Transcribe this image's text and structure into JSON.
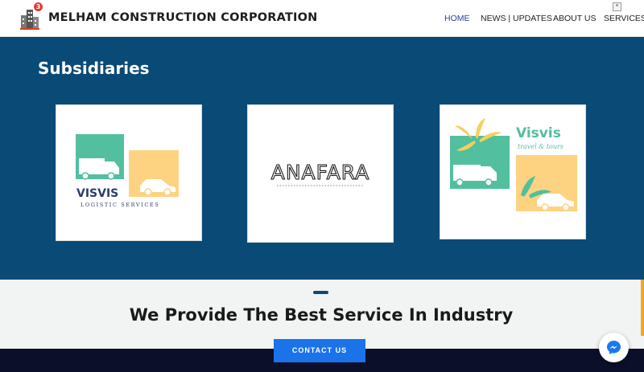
{
  "header": {
    "brand": "MELHAM CONSTRUCTION CORPORATION",
    "notification_count": "3",
    "nav": [
      {
        "label": "HOME",
        "active": true
      },
      {
        "label": "NEWS | UPDATES",
        "active": false
      },
      {
        "label": "ABOUT US",
        "active": false
      },
      {
        "label": "SERVICES",
        "active": false
      }
    ]
  },
  "subsidiaries": {
    "title": "Subsidiaries",
    "cards": [
      {
        "name": "VISVIS",
        "tagline": "LOGISTIC SERVICES"
      },
      {
        "name": "ANAFARA"
      },
      {
        "name": "Visvis",
        "tagline": "travel & tours"
      }
    ]
  },
  "service": {
    "title": "We Provide The Best Service In Industry",
    "button": "CONTACT US"
  },
  "colors": {
    "band": "#0a4a76",
    "button": "#1a73e8",
    "footer": "#0b0f2a",
    "teal": "#52bf9e",
    "peach": "#fdd382"
  }
}
